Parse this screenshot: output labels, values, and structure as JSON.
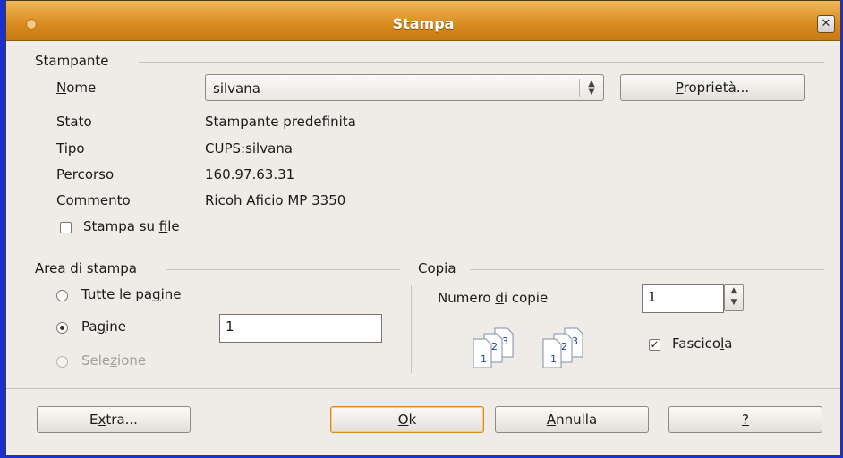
{
  "window": {
    "title": "Stampa"
  },
  "printer_section": {
    "header": "Stampante",
    "name_label": "Nome",
    "name_value": "silvana",
    "properties_button": "Proprietà...",
    "status_label": "Stato",
    "status_value": "Stampante predefinita",
    "type_label": "Tipo",
    "type_value": "CUPS:silvana",
    "path_label": "Percorso",
    "path_value": "160.97.63.31",
    "comment_label": "Commento",
    "comment_value": "Ricoh Aficio MP 3350",
    "print_to_file_label": "Stampa su file",
    "print_to_file_checked": false
  },
  "print_area": {
    "header": "Area di stampa",
    "all_pages_label": "Tutte le pagine",
    "pages_label": "Pagine",
    "pages_value": "1",
    "selection_label": "Selezione",
    "selected": "Pagine"
  },
  "copies": {
    "header": "Copia",
    "count_label": "Numero di copie",
    "count_value": "1",
    "collate_label": "Fascicola",
    "collate_checked": true
  },
  "buttons": {
    "extra": "Extra...",
    "ok": "Ok",
    "cancel": "Annulla",
    "help": "?"
  }
}
